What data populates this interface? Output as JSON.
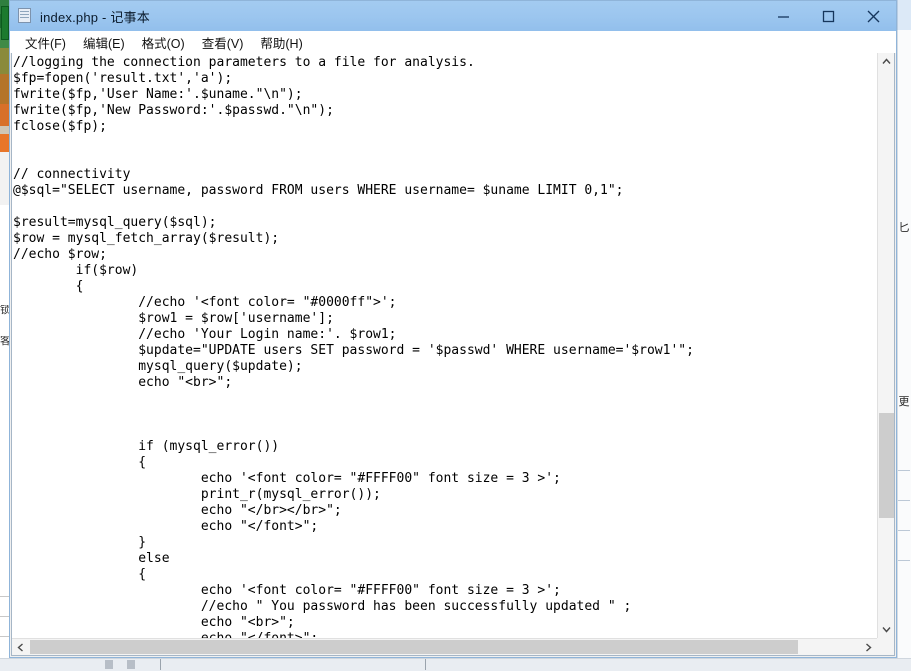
{
  "window": {
    "title": "index.php - 记事本",
    "icon": "notepad-document-icon",
    "title_bar_color": "#9cc6ef",
    "controls": {
      "minimize": "–",
      "maximize": "□",
      "close": "✕"
    }
  },
  "menu": {
    "items": [
      {
        "label": "文件(F)",
        "name": "file"
      },
      {
        "label": "编辑(E)",
        "name": "edit"
      },
      {
        "label": "格式(O)",
        "name": "format"
      },
      {
        "label": "查看(V)",
        "name": "view"
      },
      {
        "label": "帮助(H)",
        "name": "help"
      }
    ]
  },
  "editor": {
    "content": "//logging the connection parameters to a file for analysis.\n$fp=fopen('result.txt','a');\nfwrite($fp,'User Name:'.$uname.\"\\n\");\nfwrite($fp,'New Password:'.$passwd.\"\\n\");\nfclose($fp);\n\n\n// connectivity\n@$sql=\"SELECT username, password FROM users WHERE username= $uname LIMIT 0,1\";\n\n$result=mysql_query($sql);\n$row = mysql_fetch_array($result);\n//echo $row;\n        if($row)\n        {\n                //echo '<font color= \"#0000ff\">';\n                $row1 = $row['username'];\n                //echo 'Your Login name:'. $row1;\n                $update=\"UPDATE users SET password = '$passwd' WHERE username='$row1'\";\n                mysql_query($update);\n                echo \"<br>\";\n\n\n\n                if (mysql_error())\n                {\n                        echo '<font color= \"#FFFF00\" font size = 3 >';\n                        print_r(mysql_error());\n                        echo \"</br></br>\";\n                        echo \"</font>\";\n                }\n                else\n                {\n                        echo '<font color= \"#FFFF00\" font size = 3 >';\n                        //echo \" You password has been successfully updated \" ;\n                        echo \"<br>\";\n                        echo \"</font>\";"
  },
  "scrollbars": {
    "vertical": {
      "up_arrow": "▲",
      "down_arrow": "▼",
      "thumb_top_pct": 60,
      "thumb_height_pct": 18
    },
    "horizontal": {
      "left_arrow": "◀",
      "right_arrow": "▶",
      "thumb_left_pct": 2,
      "thumb_width_pct": 90
    }
  },
  "background": {
    "left_labels": [
      "锁",
      "客"
    ],
    "right_labels": [
      "匕",
      "更"
    ]
  }
}
